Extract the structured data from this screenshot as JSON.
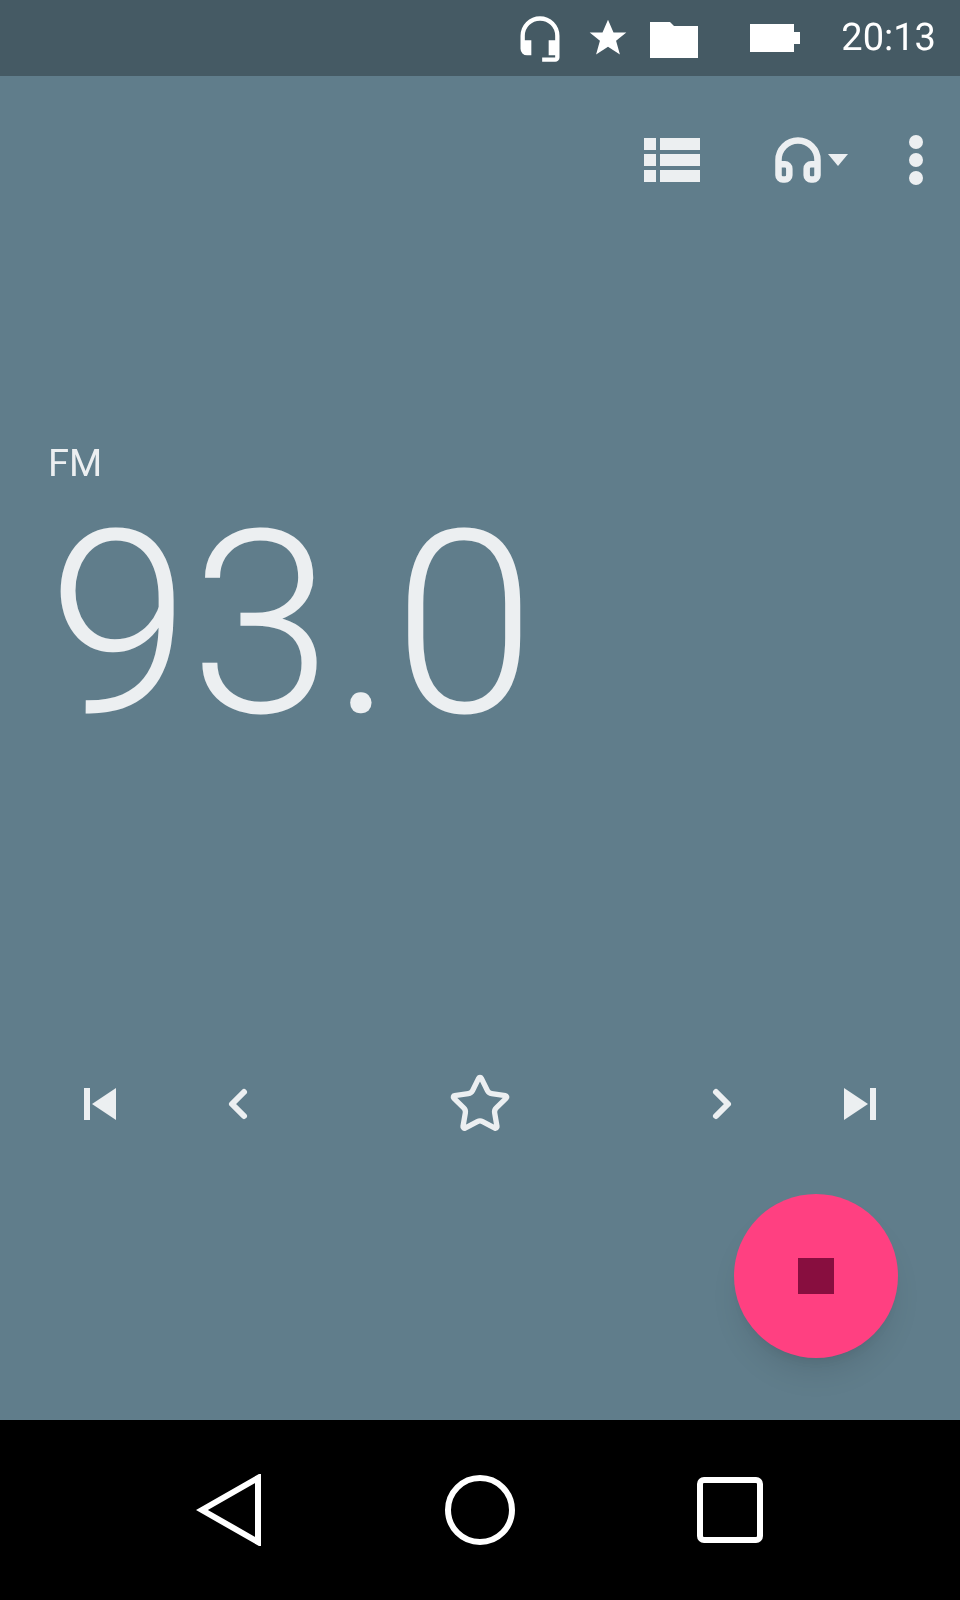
{
  "status_bar": {
    "time": "20:13"
  },
  "station": {
    "band": "FM",
    "frequency": "93.0",
    "favorite": false
  },
  "recording": true
}
